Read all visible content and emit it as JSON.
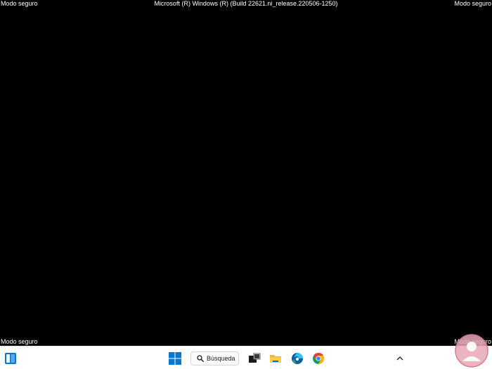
{
  "overlay": {
    "top_left": "Modo seguro",
    "top_center": "Microsoft (R) Windows (R) (Build 22621.ni_release.220506-1250)",
    "top_right": "Modo seguro",
    "bottom_left": "Modo seguro",
    "bottom_right": "Modo seguro"
  },
  "taskbar": {
    "search_label": "Búsqueda",
    "icons": {
      "widgets": "widgets-icon",
      "start": "windows-start-icon",
      "search": "search-icon",
      "task_view": "task-view-icon",
      "file_explorer": "file-explorer-icon",
      "edge": "edge-icon",
      "chrome": "chrome-icon",
      "overflow": "chevron-up-icon"
    }
  },
  "colors": {
    "desktop": "#000000",
    "taskbar": "#ffffff",
    "windows_blue": "#0078d4",
    "folder_yellow": "#f3b82b",
    "chrome_red": "#db4437",
    "chrome_yellow": "#f4b400",
    "chrome_green": "#0f9d58",
    "chrome_blue": "#4285f4"
  }
}
